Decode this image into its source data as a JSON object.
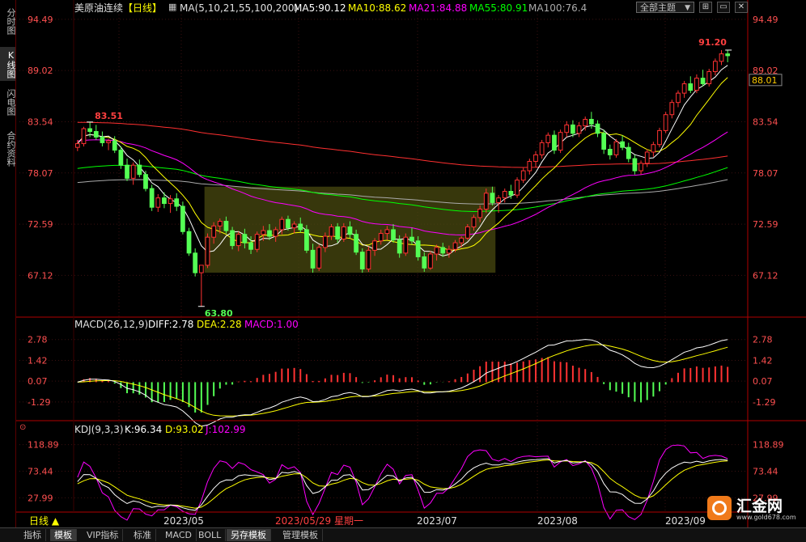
{
  "left_tabs": [
    {
      "label": "分时图",
      "active": false
    },
    {
      "label": "K线图",
      "active": true
    },
    {
      "label": "闪电图",
      "active": false
    },
    {
      "label": "合约资料",
      "active": false
    }
  ],
  "header": {
    "instrument": "美原油连续",
    "period": "【日线】",
    "ma_params": "MA(5,10,21,55,100,200)",
    "ma5": "MA5:90.12",
    "ma10": "MA10:88.62",
    "ma21": "MA21:84.88",
    "ma55": "MA55:80.91",
    "ma100": "MA100:76.4",
    "theme_select": "全部主题",
    "theme_arrow": "▼"
  },
  "price_axis": {
    "ticks": [
      "94.49",
      "89.02",
      "83.54",
      "78.07",
      "72.59",
      "67.12"
    ],
    "last_price": "88.01"
  },
  "annotations": {
    "high_label": "83.51",
    "low_label": "63.80",
    "recent_high_label": "91.20"
  },
  "macd_panel": {
    "title": "MACD(26,12,9)",
    "diff": "DIFF:2.78",
    "dea": "DEA:2.28",
    "macd": "MACD:1.00",
    "ticks": [
      "2.78",
      "1.42",
      "0.07",
      "-1.29"
    ]
  },
  "kdj_panel": {
    "title": "KDJ(9,3,3)",
    "k": "K:96.34",
    "d": "D:93.02",
    "j": "J:102.99",
    "ticks": [
      "118.89",
      "73.44",
      "27.99"
    ]
  },
  "time_axis": {
    "period_label": "日线",
    "period_arrow": "▲",
    "labels": [
      "2023/05",
      "2023/05/29 星期一",
      "2023/07",
      "2023/08",
      "2023/09"
    ]
  },
  "bottom_tabs": [
    {
      "label": "指标",
      "active": false
    },
    {
      "label": "模板",
      "active": true
    },
    {
      "label": "VIP指标",
      "active": false
    },
    {
      "label": "标准",
      "active": false
    },
    {
      "label": "MACD",
      "active": false
    },
    {
      "label": "BOLL",
      "active": false
    },
    {
      "label": "另存模板",
      "active": true
    },
    {
      "label": "管理模板",
      "active": false
    }
  ],
  "logo": {
    "text": "汇金网",
    "url_text": "www.gold678.com"
  },
  "colors": {
    "up": "#ff3232",
    "down": "#54ff54",
    "ma5": "#ffffff",
    "ma10": "#ffff00",
    "ma21": "#ff00ff",
    "ma55": "#00ff00",
    "ma100": "#aaaaaa",
    "ma200": "#ff3030",
    "box": "#4a4a10",
    "axis": "#b00000"
  },
  "chart_data": {
    "type": "candlestick",
    "ylim": [
      63,
      95
    ],
    "highest": 83.51,
    "lowest": 63.8,
    "recent_high": 91.2,
    "candles": [
      [
        80.8,
        81.6,
        80.4,
        81.2
      ],
      [
        81.2,
        83.0,
        80.9,
        82.8
      ],
      [
        82.8,
        83.51,
        81.9,
        82.5
      ],
      [
        82.5,
        83.2,
        81.6,
        81.9
      ],
      [
        81.9,
        82.5,
        80.9,
        81.3
      ],
      [
        81.3,
        81.7,
        80.5,
        81.5
      ],
      [
        81.5,
        82.0,
        80.2,
        80.5
      ],
      [
        80.5,
        80.9,
        78.5,
        78.9
      ],
      [
        78.9,
        79.6,
        77.2,
        77.5
      ],
      [
        77.5,
        79.2,
        76.8,
        78.9
      ],
      [
        78.9,
        79.5,
        77.6,
        77.9
      ],
      [
        77.9,
        78.3,
        76.1,
        76.4
      ],
      [
        76.4,
        76.8,
        74.0,
        74.4
      ],
      [
        74.4,
        75.8,
        73.9,
        75.4
      ],
      [
        75.4,
        76.0,
        74.3,
        74.8
      ],
      [
        74.8,
        75.7,
        73.8,
        75.3
      ],
      [
        75.3,
        75.9,
        74.0,
        74.5
      ],
      [
        74.5,
        75.0,
        71.5,
        71.8
      ],
      [
        71.8,
        72.2,
        69.2,
        69.5
      ],
      [
        69.5,
        70.0,
        67.0,
        67.4
      ],
      [
        67.4,
        67.9,
        63.8,
        68.2
      ],
      [
        68.2,
        71.6,
        67.9,
        71.2
      ],
      [
        71.2,
        72.8,
        70.5,
        72.4
      ],
      [
        72.4,
        73.2,
        71.6,
        72.9
      ],
      [
        72.9,
        73.4,
        71.6,
        71.9
      ],
      [
        71.9,
        72.3,
        69.9,
        70.3
      ],
      [
        70.3,
        71.8,
        69.7,
        71.5
      ],
      [
        71.5,
        72.1,
        70.0,
        70.6
      ],
      [
        70.6,
        71.3,
        69.4,
        69.9
      ],
      [
        69.9,
        71.8,
        69.6,
        71.5
      ],
      [
        71.5,
        72.4,
        70.8,
        71.9
      ],
      [
        71.9,
        72.6,
        70.9,
        71.3
      ],
      [
        71.3,
        72.3,
        70.7,
        72.0
      ],
      [
        72.0,
        73.4,
        71.5,
        73.1
      ],
      [
        73.1,
        73.5,
        71.9,
        72.2
      ],
      [
        72.2,
        72.9,
        71.6,
        72.6
      ],
      [
        72.6,
        73.3,
        71.7,
        72.0
      ],
      [
        72.0,
        72.5,
        69.5,
        69.8
      ],
      [
        69.8,
        70.5,
        67.4,
        67.9
      ],
      [
        67.9,
        70.4,
        67.6,
        70.1
      ],
      [
        70.1,
        71.7,
        69.6,
        71.3
      ],
      [
        71.3,
        72.6,
        70.9,
        72.3
      ],
      [
        72.3,
        72.7,
        70.6,
        71.0
      ],
      [
        71.0,
        72.7,
        70.7,
        72.3
      ],
      [
        72.3,
        72.9,
        71.1,
        71.5
      ],
      [
        71.5,
        72.0,
        69.3,
        69.6
      ],
      [
        69.6,
        70.0,
        67.4,
        67.8
      ],
      [
        67.8,
        70.2,
        67.5,
        69.8
      ],
      [
        69.8,
        71.1,
        69.2,
        70.8
      ],
      [
        70.8,
        72.0,
        70.4,
        71.6
      ],
      [
        71.6,
        72.4,
        70.9,
        72.0
      ],
      [
        72.0,
        72.6,
        70.6,
        70.9
      ],
      [
        70.9,
        71.4,
        69.0,
        69.5
      ],
      [
        69.5,
        71.6,
        69.2,
        71.2
      ],
      [
        71.2,
        72.2,
        70.4,
        70.8
      ],
      [
        70.8,
        71.3,
        68.7,
        69.1
      ],
      [
        69.1,
        69.6,
        67.5,
        67.9
      ],
      [
        67.9,
        69.7,
        67.7,
        69.4
      ],
      [
        69.4,
        70.4,
        68.7,
        70.1
      ],
      [
        70.1,
        70.6,
        69.1,
        69.5
      ],
      [
        69.5,
        70.3,
        69.0,
        69.9
      ],
      [
        69.9,
        70.9,
        69.6,
        70.6
      ],
      [
        70.6,
        71.3,
        70.1,
        71.1
      ],
      [
        71.1,
        72.6,
        70.9,
        72.3
      ],
      [
        72.3,
        73.6,
        71.9,
        73.3
      ],
      [
        73.3,
        74.6,
        72.8,
        74.2
      ],
      [
        74.2,
        76.4,
        73.8,
        75.9
      ],
      [
        75.9,
        76.6,
        74.6,
        74.9
      ],
      [
        74.9,
        75.7,
        73.8,
        75.4
      ],
      [
        75.4,
        76.4,
        74.9,
        76.1
      ],
      [
        76.1,
        76.8,
        75.3,
        75.7
      ],
      [
        75.7,
        77.6,
        75.4,
        77.3
      ],
      [
        77.3,
        78.6,
        77.0,
        78.3
      ],
      [
        78.3,
        79.6,
        77.9,
        79.3
      ],
      [
        79.3,
        80.4,
        78.7,
        80.0
      ],
      [
        80.0,
        81.6,
        79.6,
        81.3
      ],
      [
        81.3,
        82.4,
        80.8,
        82.1
      ],
      [
        82.1,
        82.6,
        80.1,
        80.5
      ],
      [
        80.5,
        82.7,
        80.2,
        82.4
      ],
      [
        82.4,
        83.6,
        81.9,
        83.2
      ],
      [
        83.2,
        83.7,
        81.9,
        82.3
      ],
      [
        82.3,
        83.5,
        81.9,
        83.1
      ],
      [
        83.1,
        84.1,
        82.6,
        83.8
      ],
      [
        83.8,
        84.6,
        82.8,
        83.3
      ],
      [
        83.3,
        83.7,
        81.9,
        82.3
      ],
      [
        82.3,
        82.7,
        80.1,
        80.6
      ],
      [
        80.6,
        81.1,
        79.5,
        80.0
      ],
      [
        80.0,
        81.7,
        79.7,
        81.4
      ],
      [
        81.4,
        82.1,
        80.5,
        80.8
      ],
      [
        80.8,
        81.3,
        79.2,
        79.6
      ],
      [
        79.6,
        80.0,
        77.9,
        78.3
      ],
      [
        78.3,
        79.4,
        77.9,
        79.1
      ],
      [
        79.1,
        80.6,
        78.7,
        80.3
      ],
      [
        80.3,
        81.4,
        79.8,
        81.1
      ],
      [
        81.1,
        82.9,
        80.8,
        82.6
      ],
      [
        82.6,
        84.6,
        82.3,
        84.3
      ],
      [
        84.3,
        85.9,
        83.9,
        85.6
      ],
      [
        85.6,
        86.9,
        85.1,
        86.6
      ],
      [
        86.6,
        87.9,
        86.1,
        87.6
      ],
      [
        87.6,
        88.4,
        86.6,
        86.9
      ],
      [
        86.9,
        88.6,
        86.6,
        88.2
      ],
      [
        88.2,
        89.1,
        87.3,
        87.6
      ],
      [
        87.6,
        89.2,
        87.3,
        88.9
      ],
      [
        88.9,
        90.3,
        88.5,
        90.0
      ],
      [
        90.0,
        91.2,
        89.6,
        90.8
      ],
      [
        90.8,
        91.2,
        89.9,
        90.6
      ]
    ],
    "macd": {
      "ylim": [
        -2.3,
        3.4
      ],
      "diff": 2.78,
      "dea": 2.28,
      "macd": 1.0
    },
    "kdj": {
      "ylim": [
        5,
        135
      ],
      "k": 96.34,
      "d": 93.02,
      "j": 102.99
    }
  }
}
